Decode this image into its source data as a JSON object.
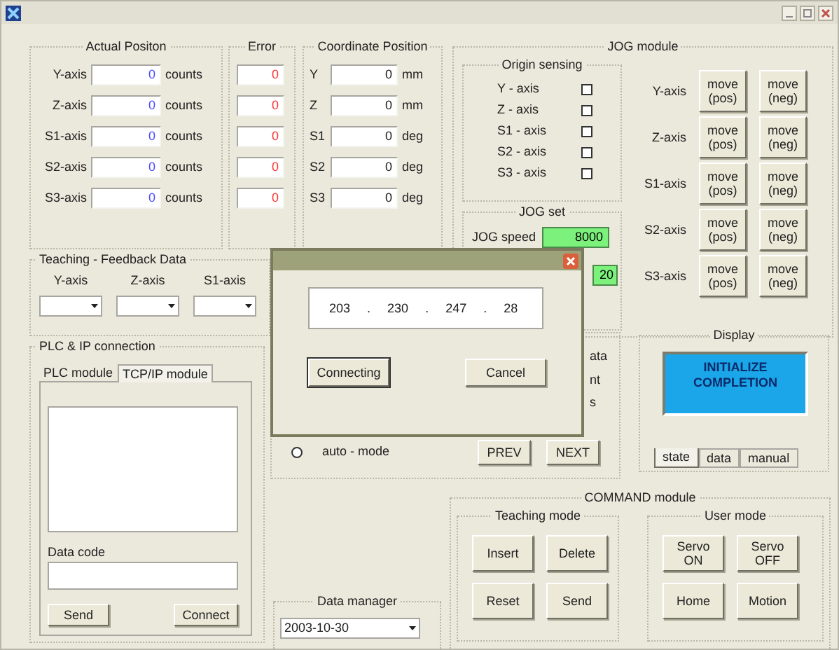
{
  "actual_position": {
    "title": "Actual Positon",
    "rows": [
      {
        "label": "Y-axis",
        "value": "0",
        "unit": "counts"
      },
      {
        "label": "Z-axis",
        "value": "0",
        "unit": "counts"
      },
      {
        "label": "S1-axis",
        "value": "0",
        "unit": "counts"
      },
      {
        "label": "S2-axis",
        "value": "0",
        "unit": "counts"
      },
      {
        "label": "S3-axis",
        "value": "0",
        "unit": "counts"
      }
    ]
  },
  "error": {
    "title": "Error",
    "values": [
      "0",
      "0",
      "0",
      "0",
      "0"
    ]
  },
  "coordinate_position": {
    "title": "Coordinate Position",
    "rows": [
      {
        "label": "Y",
        "value": "0",
        "unit": "mm"
      },
      {
        "label": "Z",
        "value": "0",
        "unit": "mm"
      },
      {
        "label": "S1",
        "value": "0",
        "unit": "deg"
      },
      {
        "label": "S2",
        "value": "0",
        "unit": "deg"
      },
      {
        "label": "S3",
        "value": "0",
        "unit": "deg"
      }
    ]
  },
  "jog_module": {
    "title": "JOG module",
    "origin_sensing": {
      "title": "Origin sensing",
      "items": [
        {
          "label": "Y - axis",
          "checked": false
        },
        {
          "label": "Z - axis",
          "checked": false
        },
        {
          "label": "S1 - axis",
          "checked": false
        },
        {
          "label": "S2 - axis",
          "checked": false
        },
        {
          "label": "S3 - axis",
          "checked": false
        }
      ]
    },
    "jog_set": {
      "title": "JOG set",
      "speed_label": "JOG speed",
      "speed": "8000",
      "second_value": "20"
    },
    "axes": [
      {
        "label": "Y-axis",
        "buttons": [
          "move (pos)",
          "move (neg)"
        ]
      },
      {
        "label": "Z-axis",
        "buttons": [
          "move (pos)",
          "move (neg)"
        ]
      },
      {
        "label": "S1-axis",
        "buttons": [
          "move (pos)",
          "move (neg)"
        ]
      },
      {
        "label": "S2-axis",
        "buttons": [
          "move (pos)",
          "move (neg)"
        ]
      },
      {
        "label": "S3-axis",
        "buttons": [
          "move (pos)",
          "move (neg)"
        ]
      }
    ]
  },
  "teaching_feedback": {
    "title": "Teaching - Feedback Data",
    "columns": [
      "Y-axis",
      "Z-axis",
      "S1-axis"
    ]
  },
  "plc_ip": {
    "title": "PLC & IP connection",
    "tabs": [
      {
        "label": "PLC module",
        "selected": false
      },
      {
        "label": "TCP/IP module",
        "selected": true
      }
    ],
    "data_code_label": "Data code",
    "buttons": [
      "Send",
      "Connect"
    ]
  },
  "mode_panel": {
    "partial_labels": [
      "ata",
      "nt",
      "s"
    ],
    "radio": {
      "label": "auto - mode",
      "selected": false
    },
    "buttons": [
      "PREV",
      "NEXT"
    ]
  },
  "display": {
    "title": "Display",
    "message": "INITIALIZE COMPLETION",
    "tabs": [
      {
        "label": "state",
        "selected": true
      },
      {
        "label": "data",
        "selected": false
      },
      {
        "label": "manual",
        "selected": false
      }
    ]
  },
  "data_manager": {
    "title": "Data manager",
    "value": "2003-10-30"
  },
  "command": {
    "title": "COMMAND module",
    "groups": [
      {
        "title": "Teaching mode",
        "buttons": [
          "Insert",
          "Delete",
          "Reset",
          "Send"
        ]
      },
      {
        "title": "User mode",
        "buttons": [
          "Servo ON",
          "Servo OFF",
          "Home",
          "Motion"
        ]
      }
    ]
  },
  "dialog": {
    "ip": [
      "203",
      "230",
      "247",
      "28"
    ],
    "ip_separator": ".",
    "buttons": [
      {
        "label": "Connecting",
        "focused": true
      },
      {
        "label": "Cancel",
        "focused": false
      }
    ]
  }
}
